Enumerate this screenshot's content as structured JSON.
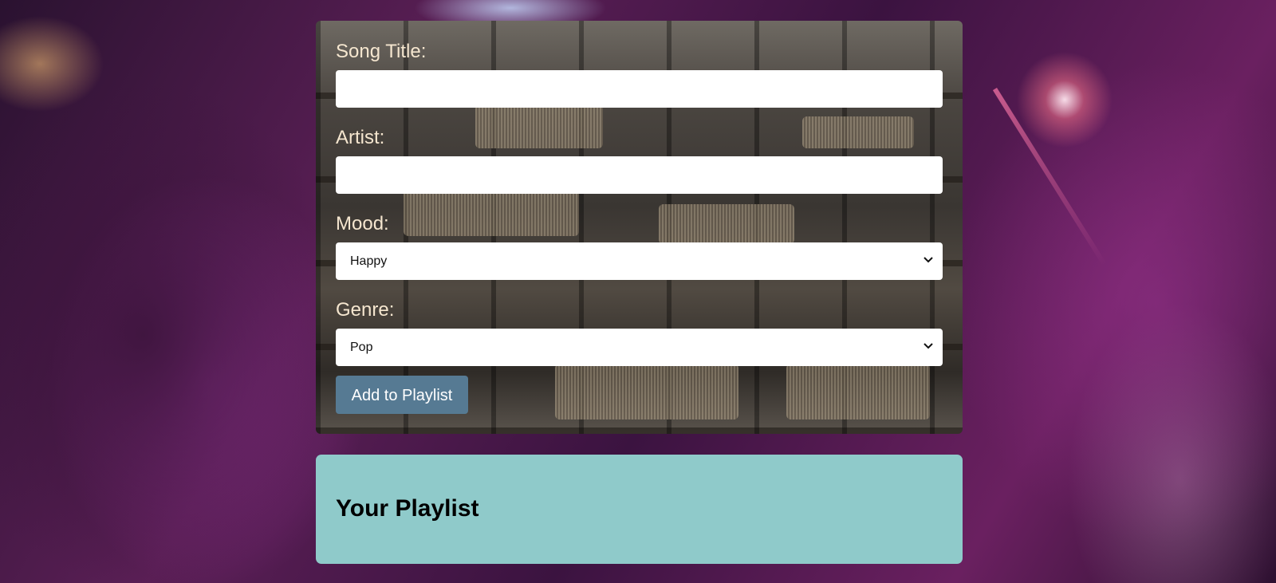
{
  "form": {
    "song_title_label": "Song Title:",
    "song_title_value": "",
    "artist_label": "Artist:",
    "artist_value": "",
    "mood_label": "Mood:",
    "mood_selected": "Happy",
    "genre_label": "Genre:",
    "genre_selected": "Pop",
    "add_button_label": "Add to Playlist"
  },
  "playlist": {
    "title": "Your Playlist"
  },
  "icons": {
    "select_arrow": "chevron-down-icon"
  },
  "colors": {
    "label_text": "#f5e6cf",
    "button_bg": "#567a93",
    "playlist_bg": "#8fcaca"
  }
}
